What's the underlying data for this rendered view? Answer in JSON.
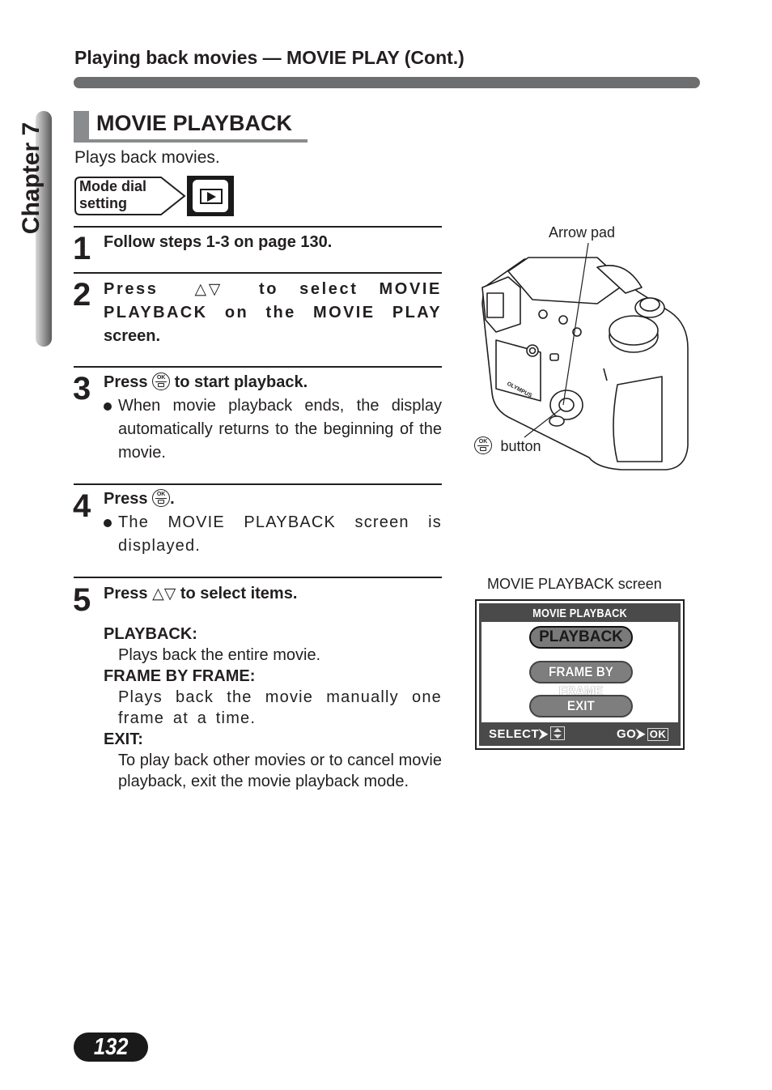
{
  "header": {
    "title": "Playing back movies — MOVIE PLAY (Cont.)"
  },
  "chapter_tab": {
    "label": "Chapter 7"
  },
  "section": {
    "heading": "MOVIE PLAYBACK",
    "intro": "Plays back movies.",
    "mode_dial": {
      "label_line1": "Mode dial",
      "label_line2": "setting",
      "icon": "playback-mode-icon"
    }
  },
  "steps": [
    {
      "number": "1",
      "text": "Follow steps 1-3 on page 130."
    },
    {
      "number": "2",
      "text_before": "Press",
      "icons": [
        "up-arrow-icon",
        "down-arrow-icon"
      ],
      "text_after_1": "to select MOVIE",
      "text_line2": "PLAYBACK on the MOVIE PLAY",
      "text_line3": "screen."
    },
    {
      "number": "3",
      "text_before": "Press",
      "icon": "ok-button-icon",
      "text_after": "to start playback.",
      "bullets": [
        "When movie playback ends, the display automatically returns to the beginning of the movie."
      ]
    },
    {
      "number": "4",
      "text_before": "Press",
      "icon": "ok-button-icon",
      "text_after": ".",
      "bullets": [
        "The MOVIE PLAYBACK screen is displayed."
      ]
    },
    {
      "number": "5",
      "text_before": "Press",
      "icons": [
        "up-arrow-icon",
        "down-arrow-icon"
      ],
      "text_after": "to select items.",
      "items": [
        {
          "name": "PLAYBACK:",
          "desc": "Plays back the entire movie."
        },
        {
          "name": "FRAME BY FRAME:",
          "desc": "Plays back the movie manually one frame at a time."
        },
        {
          "name": "EXIT:",
          "desc": "To play back other movies or to cancel movie playback, exit the movie playback mode."
        }
      ]
    }
  ],
  "symbols": {
    "up": "△",
    "down": "▽",
    "ok": "OK"
  },
  "camera_figure": {
    "arrow_pad_label": "Arrow pad",
    "ok_button_label": "button",
    "brand": "OLYMPUS"
  },
  "lcd_figure": {
    "caption": "MOVIE PLAYBACK screen",
    "title": "MOVIE PLAYBACK",
    "options": [
      {
        "label": "PLAYBACK",
        "selected": true
      },
      {
        "label": "FRAME BY FRAME",
        "selected": false
      },
      {
        "label": "EXIT",
        "selected": false
      }
    ],
    "footer_select": "SELECT",
    "footer_go": "GO",
    "footer_ok": "OK"
  },
  "page_number": "132"
}
